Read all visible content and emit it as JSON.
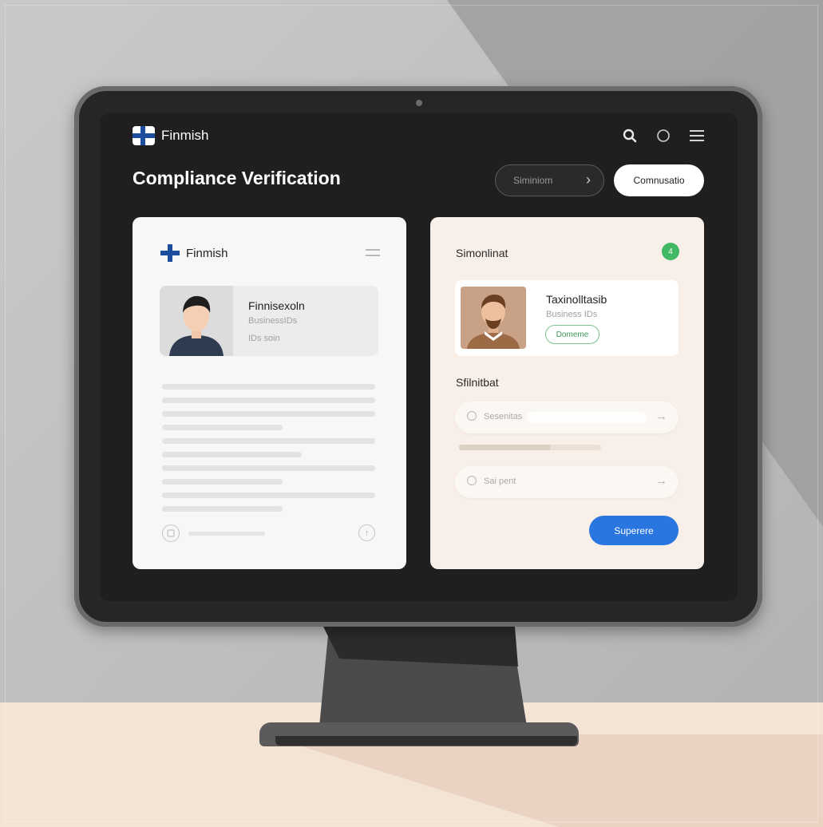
{
  "app": {
    "brand": "Finmish"
  },
  "header": {
    "title": "Compliance Verification"
  },
  "actions": {
    "secondary_label": "Siminiom",
    "primary_label": "Comnusatio"
  },
  "left_card": {
    "brand": "Finmish",
    "profile": {
      "name": "Finnisexoln",
      "line1": "BusinessIDs",
      "line2": "IDs soin"
    }
  },
  "right_card": {
    "heading": "Simonlinat",
    "badge": "4",
    "profile": {
      "name": "Taxinolltasib",
      "subtitle": "Business IDs",
      "status": "Domeme"
    },
    "section_title": "Sfilnitbat",
    "input1_label": "Sesenitas",
    "input2_label": "Sai pent",
    "progress": 0.64,
    "submit_label": "Superere"
  },
  "colors": {
    "accent_blue": "#2a76e0",
    "success_green": "#43b864",
    "flag_blue": "#1d4e9e"
  }
}
